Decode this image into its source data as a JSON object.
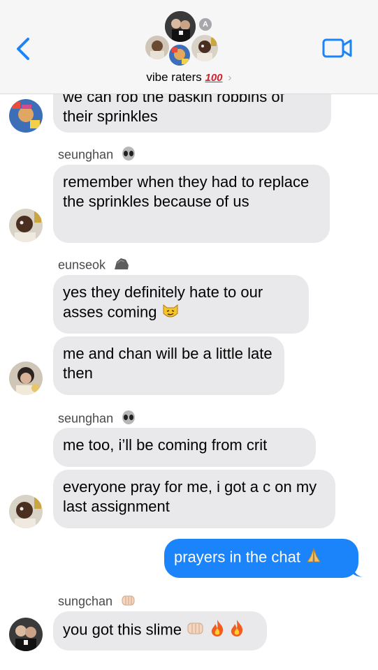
{
  "header": {
    "group_name": "vibe raters",
    "group_emoji": "100",
    "avatar_badge": "A",
    "icons": {
      "back": "chevron-left-icon",
      "video": "video-camera-icon",
      "disclosure": "chevron-right-icon"
    }
  },
  "colors": {
    "accent": "#1b84fb",
    "incoming_bubble": "#e9e9eb",
    "header_bg": "#f6f6f6"
  },
  "messages": [
    {
      "type": "in",
      "text_line1": "we can rob the baskin robbins of",
      "text_line2": "their sprinkles"
    },
    {
      "type": "sender",
      "name": "seunghan",
      "emoji": "alien-icon"
    },
    {
      "type": "in",
      "text": "remember when they had to replace the sprinkles because of us"
    },
    {
      "type": "sender",
      "name": "eunseok",
      "emoji": "rock-icon"
    },
    {
      "type": "in",
      "text": "yes they definitely hate to our asses coming",
      "emoji": "smirking-cat-icon"
    },
    {
      "type": "in",
      "text": "me and chan will be a little late then"
    },
    {
      "type": "sender",
      "name": "seunghan",
      "emoji": "alien-icon"
    },
    {
      "type": "in",
      "text": "me too, i’ll be coming from crit"
    },
    {
      "type": "in",
      "text": "everyone pray for me, i got a c on my last assignment"
    },
    {
      "type": "out",
      "text": "prayers in the chat",
      "emoji": "folded-hands-icon"
    },
    {
      "type": "sender",
      "name": "sungchan",
      "emoji": "fist-bump-icon"
    },
    {
      "type": "in",
      "text": "you got this slime",
      "emoji": "fist-bump-fire-fire-icons"
    }
  ]
}
